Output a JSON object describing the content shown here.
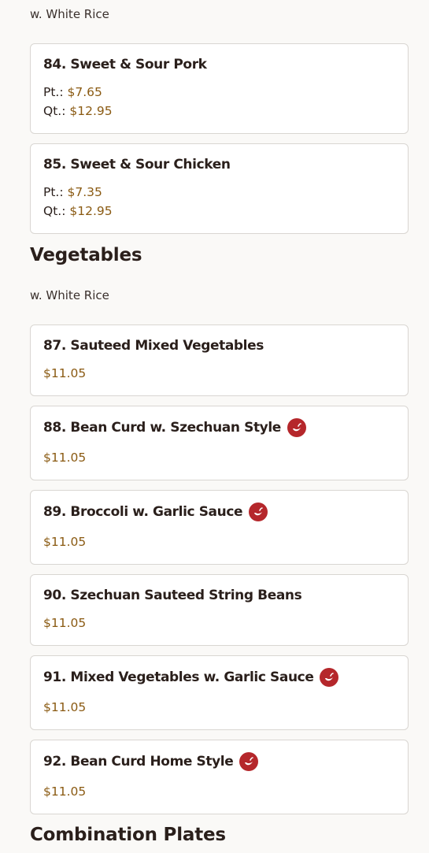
{
  "top_note": "w. White Rice",
  "sweet_sour": [
    {
      "name": "84. Sweet & Sour Pork",
      "pt_label": "Pt.:",
      "pt_price": "$7.65",
      "qt_label": "Qt.:",
      "qt_price": "$12.95"
    },
    {
      "name": "85. Sweet & Sour Chicken",
      "pt_label": "Pt.:",
      "pt_price": "$7.35",
      "qt_label": "Qt.:",
      "qt_price": "$12.95"
    }
  ],
  "vegetables": {
    "title": "Vegetables",
    "note": "w. White Rice",
    "items": [
      {
        "name": "87. Sauteed Mixed Vegetables",
        "price": "$11.05",
        "spicy": false
      },
      {
        "name": "88. Bean Curd w. Szechuan Style",
        "price": "$11.05",
        "spicy": true
      },
      {
        "name": "89. Broccoli w. Garlic Sauce",
        "price": "$11.05",
        "spicy": true
      },
      {
        "name": "90. Szechuan Sauteed String Beans",
        "price": "$11.05",
        "spicy": false
      },
      {
        "name": "91. Mixed Vegetables w. Garlic Sauce",
        "price": "$11.05",
        "spicy": true
      },
      {
        "name": "92. Bean Curd Home Style",
        "price": "$11.05",
        "spicy": true
      }
    ]
  },
  "next_section": {
    "title": "Combination Plates"
  },
  "icons": {
    "spicy": "chili-pepper-icon"
  },
  "colors": {
    "price": "#8a5a12",
    "spicy_badge": "#b5272b",
    "background": "#faf9f7"
  }
}
